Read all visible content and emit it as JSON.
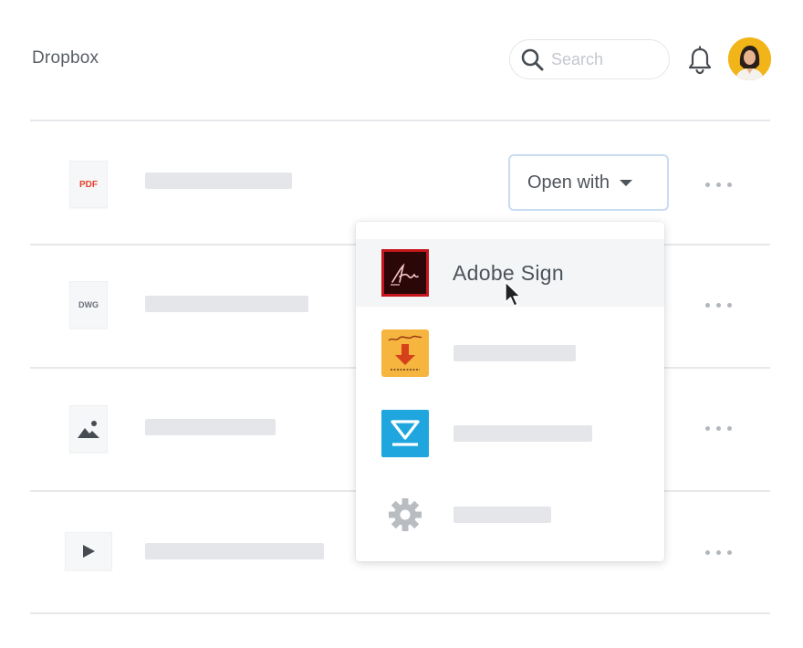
{
  "header": {
    "app_title": "Dropbox",
    "search_placeholder": "Search",
    "notification_icon": "bell-icon",
    "avatar_icon": "user-avatar"
  },
  "files": [
    {
      "type_label": "PDF",
      "type_color": "#e8412c",
      "icon": "pdf-file-icon"
    },
    {
      "type_label": "DWG",
      "type_color": "#6b7077",
      "icon": "dwg-file-icon"
    },
    {
      "type_label": "",
      "icon": "image-file-icon"
    },
    {
      "type_label": "",
      "icon": "video-file-icon"
    }
  ],
  "open_with": {
    "label": "Open with",
    "icon": "caret-down-icon",
    "menu": [
      {
        "label": "Adobe Sign",
        "icon": "adobe-sign-icon",
        "hovered": true
      },
      {
        "label": "",
        "icon": "signing-app-icon"
      },
      {
        "label": "",
        "icon": "blue-app-icon"
      },
      {
        "label": "",
        "icon": "gear-icon"
      }
    ]
  },
  "colors": {
    "divider": "#e6e8eb",
    "placeholder_bar": "#e4e6e9",
    "focus_border": "#c9dcf2",
    "adobe_red": "#c4161c",
    "signing_orange": "#f5b53f",
    "blue_app": "#1fa6de"
  }
}
